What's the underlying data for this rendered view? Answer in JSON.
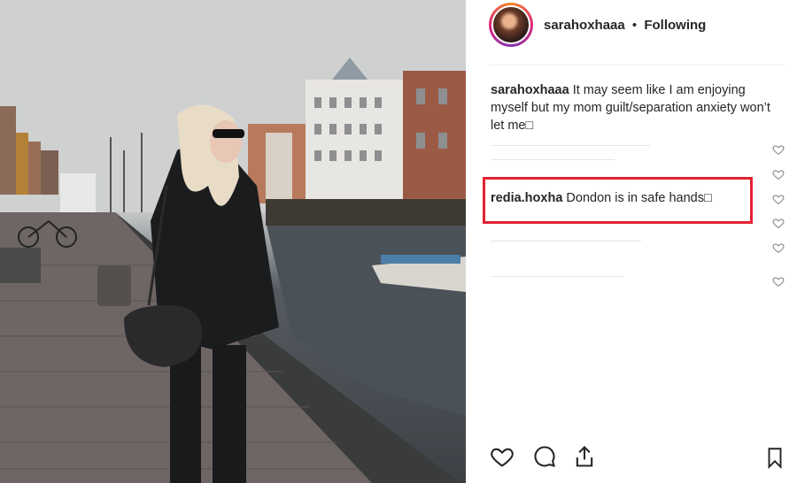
{
  "post": {
    "author": "sarahoxhaaa",
    "separator": "•",
    "follow_status": "Following",
    "caption_user": "sarahoxhaaa",
    "caption_text": "It may seem like I am enjoying myself but my mom guilt/separation anxiety won’t let me□",
    "highlighted_comment": {
      "user": "redia.hoxha",
      "text": "Dondon is in safe hands□"
    }
  },
  "colors": {
    "highlight": "#e32232",
    "text": "#262626",
    "icon": "#262626",
    "heart_outline": "#8e8e8e"
  },
  "icons": {
    "like": "heart-icon",
    "comment": "comment-bubble-icon",
    "share": "share-upload-icon",
    "save": "bookmark-icon"
  }
}
